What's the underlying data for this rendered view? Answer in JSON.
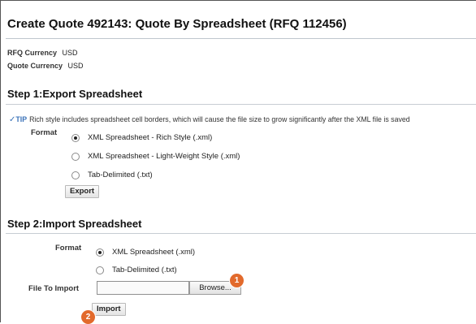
{
  "page": {
    "title": "Create Quote 492143: Quote By Spreadsheet (RFQ 112456)"
  },
  "currency": {
    "rfq_label": "RFQ Currency",
    "rfq_value": "USD",
    "quote_label": "Quote Currency",
    "quote_value": "USD"
  },
  "step1": {
    "title": "Step 1:Export Spreadsheet",
    "tip_icon": "tip-check-icon",
    "tip_label": "TIP",
    "tip_text": "Rich style includes spreadsheet cell borders, which will cause the file size to grow significantly after the XML file is saved",
    "format_label": "Format",
    "options": [
      {
        "label": "XML Spreadsheet - Rich Style (.xml)",
        "selected": true
      },
      {
        "label": "XML Spreadsheet - Light-Weight Style (.xml)",
        "selected": false
      },
      {
        "label": "Tab-Delimited (.txt)",
        "selected": false
      }
    ],
    "export_label": "Export"
  },
  "step2": {
    "title": "Step 2:Import Spreadsheet",
    "format_label": "Format",
    "options": [
      {
        "label": "XML Spreadsheet (.xml)",
        "selected": true
      },
      {
        "label": "Tab-Delimited (.txt)",
        "selected": false
      }
    ],
    "file_label": "File To Import",
    "file_value": "",
    "browse_label": "Browse...",
    "import_label": "Import"
  },
  "markers": {
    "browse": "1",
    "import": "2",
    "color": "#e26a2c"
  }
}
